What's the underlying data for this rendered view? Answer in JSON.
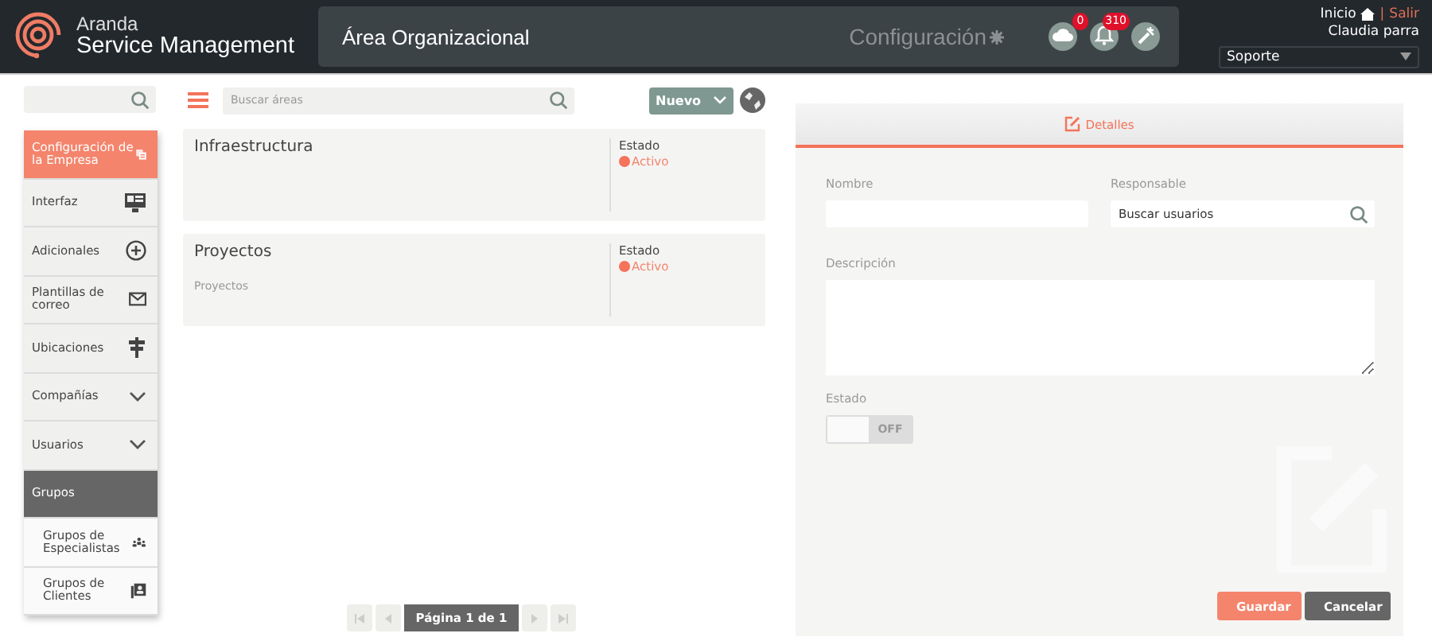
{
  "header": {
    "brand_top": "Aranda",
    "brand_bottom": "Service Management",
    "page_title": "Área Organizacional",
    "section": "Configuración",
    "notifications": [
      {
        "kind": "cloud",
        "badge": "0"
      },
      {
        "kind": "bell",
        "badge": "310"
      },
      {
        "kind": "tools"
      }
    ],
    "home_link": "Inicio",
    "separator": "|",
    "logout_link": "Salir",
    "user_name": "Claudia parra",
    "role_select": "Soporte"
  },
  "sidebar": {
    "items": [
      {
        "label": "Configuración de la Empresa",
        "kind": "item",
        "selected": true
      },
      {
        "label": "Interfaz",
        "kind": "item",
        "selected": false
      },
      {
        "label": "Adicionales",
        "kind": "item",
        "selected": false
      },
      {
        "label": "Plantillas de correo",
        "kind": "item",
        "selected": false
      },
      {
        "label": "Ubicaciones",
        "kind": "item",
        "selected": false
      },
      {
        "label": "Compañías",
        "kind": "expandable",
        "expanded": false,
        "selected": false
      },
      {
        "label": "Usuarios",
        "kind": "expandable",
        "expanded": false,
        "selected": false
      },
      {
        "label": "Grupos",
        "kind": "expandable",
        "expanded": true,
        "selected": false
      },
      {
        "label": "Grupos de Especialistas",
        "kind": "subitem",
        "selected": false
      },
      {
        "label": "Grupos de Clientes",
        "kind": "subitem",
        "selected": false
      }
    ]
  },
  "areas": {
    "search_placeholder": "Buscar áreas",
    "new_button": "Nuevo",
    "cards": [
      {
        "name": "Infraestructura",
        "status_label": "Estado",
        "status": "Activo",
        "color": "#f4735a"
      },
      {
        "name": "Proyectos",
        "description": "Proyectos",
        "status_label": "Estado",
        "status": "Activo",
        "color": "#f4735a"
      }
    ],
    "pagination": "Página 1 de 1"
  },
  "details": {
    "tab": "Detalles",
    "name_label": "Nombre",
    "owner_label": "Responsable",
    "owner_placeholder": "Buscar usuarios",
    "description_label": "Descripción",
    "status_label": "Estado",
    "status_toggle": {
      "on": false,
      "text": "OFF"
    },
    "buttons": [
      "Guardar",
      "Cancelar"
    ]
  }
}
